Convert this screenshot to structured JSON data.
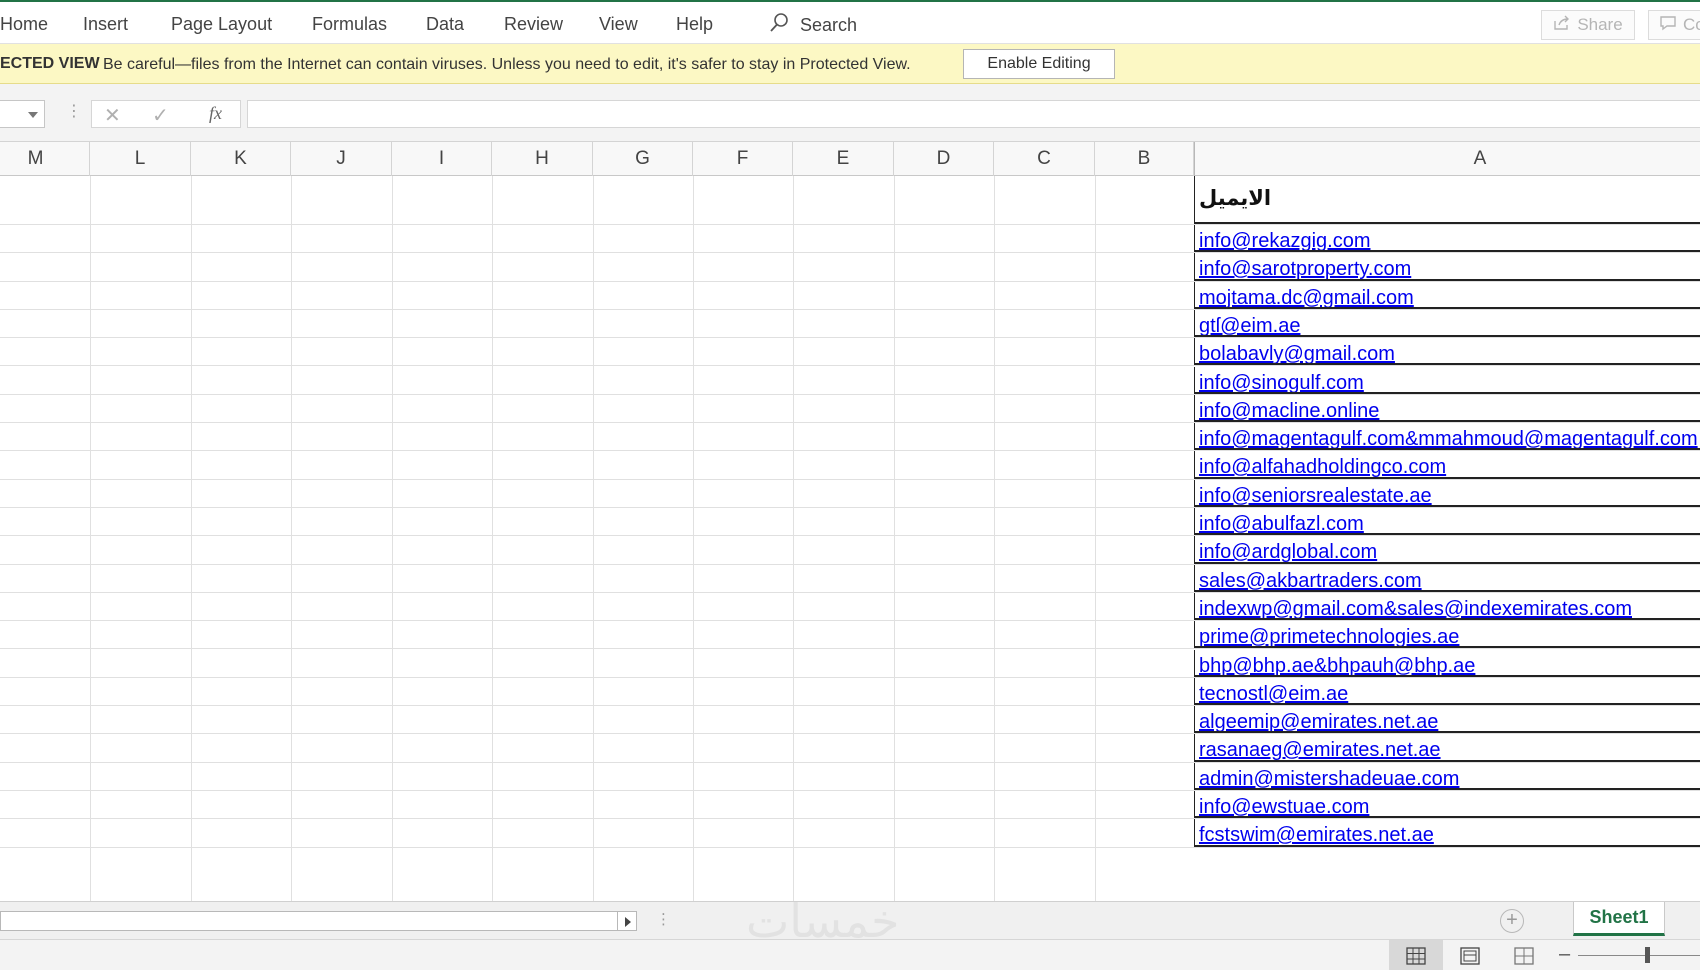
{
  "ribbon": {
    "tabs": [
      "Home",
      "Insert",
      "Page Layout",
      "Formulas",
      "Data",
      "Review",
      "View",
      "Help"
    ],
    "search_label": "Search",
    "share_label": "Share",
    "comments_label": "Co"
  },
  "protected_view": {
    "label": "ECTED VIEW",
    "message": "Be careful—files from the Internet can contain viruses. Unless you need to edit, it's safer to stay in Protected View.",
    "button_label": "Enable Editing"
  },
  "formula_bar": {
    "fx_label": "fx",
    "value": ""
  },
  "columns": [
    "M",
    "L",
    "K",
    "J",
    "I",
    "H",
    "G",
    "F",
    "E",
    "D",
    "C",
    "B",
    "A"
  ],
  "sheet": {
    "header_cell": "الايميل",
    "emails": [
      "info@rekazgig.com",
      "info@sarotproperty.com",
      "mojtama.dc@gmail.com",
      "gtſ@eim.ae",
      "bolabavly@gmail.com",
      "info@sinogulf.com",
      "info@macline.online",
      "info@magentagulf.com&mmahmoud@magentagulf.com",
      "info@alfahadholdingco.com",
      "info@seniorsrealestate.ae",
      "info@abulfazl.com",
      "info@ardglobal.com",
      "sales@akbartraders.com",
      "indexwp@gmail.com&sales@indexemirates.com",
      "prime@primetechnologies.ae",
      "bhp@bhp.ae&bhpauh@bhp.ae",
      "tecnostl@eim.ae",
      "algeemip@emirates.net.ae",
      "rasanaeg@emirates.net.ae",
      "admin@mistershadeuae.com",
      "info@ewstuae.com",
      "fcstswim@emirates.net.ae"
    ]
  },
  "tabs_bar": {
    "sheet_tab": "Sheet1",
    "watermark": "خمسات"
  },
  "colors": {
    "accent": "#217346",
    "link": "#0000ee",
    "protected_bar": "#fcf8c4"
  }
}
